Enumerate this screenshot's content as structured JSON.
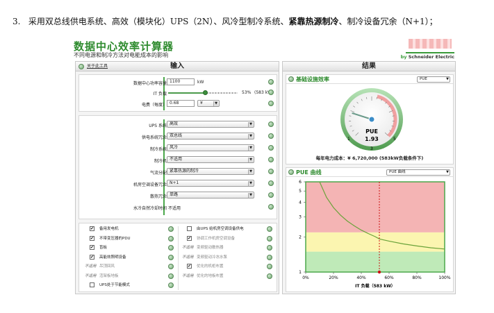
{
  "doc": {
    "pre": "3.   采用双总线供电系统、高效（模块化）UPS（2N）、风冷型制冷系统、",
    "bold": "紧靠热源制冷",
    "post": "、制冷设备冗余（N+1）；"
  },
  "app": {
    "title": "数据中心效率计算器",
    "subtitle": "不同电源和制冷方法对电能成本的影响",
    "brand_by": "by",
    "brand_name": "Schneider Electric"
  },
  "input": {
    "header": "输入",
    "about_link": "关于此工具",
    "capacity": {
      "label": "数据中心功率容量",
      "value": "1100",
      "unit": "kW"
    },
    "it_load": {
      "label": "IT 负载",
      "percent": "53%",
      "kw": "(583 kW)",
      "fraction": 0.53
    },
    "price": {
      "label": "电费（每度）",
      "value": "0.68",
      "currency": "¥"
    },
    "rows": [
      {
        "label": "UPS 系统",
        "value": "高效",
        "type": "select"
      },
      {
        "label": "供电系统冗余",
        "value": "双总线",
        "type": "select"
      },
      {
        "label": "制冷系统",
        "value": "风冷",
        "type": "select"
      },
      {
        "label": "制冷机",
        "value": "不适用",
        "type": "select"
      },
      {
        "label": "气流分配",
        "value": "紧靠热源的制冷",
        "type": "select"
      },
      {
        "label": "机房空调设备冗余",
        "value": "N+1",
        "type": "select"
      },
      {
        "label": "散热冗余",
        "value": "单路",
        "type": "select"
      },
      {
        "label": "水冷自然冷却时间",
        "value": "不适用",
        "type": "static"
      }
    ],
    "options_left": [
      {
        "na": "",
        "checked": true,
        "text": "备用发电机",
        "disabled": false
      },
      {
        "na": "",
        "checked": true,
        "text": "不带变压器的PDU",
        "disabled": false
      },
      {
        "na": "",
        "checked": true,
        "text": "盲板",
        "disabled": false
      },
      {
        "na": "",
        "checked": true,
        "text": "高能效照明设备",
        "disabled": false
      },
      {
        "na": "不适用",
        "checked": null,
        "text": "吊顶回风",
        "disabled": true
      },
      {
        "na": "不适用",
        "checked": null,
        "text": "活架板地板",
        "disabled": true
      },
      {
        "na": "",
        "checked": false,
        "text": "UPS处于节能模式",
        "disabled": false
      }
    ],
    "options_right": [
      {
        "na": "",
        "checked": false,
        "text": "由UPS 给机房空调设备供电",
        "disabled": false
      },
      {
        "na": "",
        "checked": true,
        "text": "协调工作机房空调设备",
        "disabled": true
      },
      {
        "na": "不适用",
        "checked": null,
        "text": "变频驱动散热器",
        "disabled": true
      },
      {
        "na": "不适用",
        "checked": null,
        "text": "变频驱动冷冻水泵",
        "disabled": true
      },
      {
        "na": "",
        "checked": true,
        "text": "优化的机柜布置",
        "disabled": true
      },
      {
        "na": "不适用",
        "checked": null,
        "text": "优化的地板布置",
        "disabled": true
      }
    ]
  },
  "result": {
    "header": "结果",
    "efficiency": {
      "title": "基础设施效率",
      "select": "PUE",
      "gauge_label": "PUE",
      "gauge_value": "1.93",
      "pue": 1.93,
      "gauge_min": "1",
      "gauge_mid": "3",
      "gauge_max": "5",
      "cost_label": "每年电力成本：",
      "cost_value": "¥ 6,720,000 (583kW负载条件下)"
    },
    "curve": {
      "title": "PUE 曲线",
      "select": "PUE 曲线",
      "colors": {
        "red": "#f4b4b4",
        "yellow": "#fbf5b0",
        "green": "#bfeab8",
        "line": "#6aa33a",
        "marker": "#cc1010"
      }
    }
  },
  "chart_data": {
    "type": "line",
    "title": "PUE 曲线",
    "xlabel": "IT 负载（583 kW）",
    "ylabel": "",
    "x_ticks": [
      "0%",
      "20%",
      "40%",
      "60%",
      "80%",
      "100%"
    ],
    "y_ticks": [
      "1",
      "2",
      "3",
      "4",
      "5",
      "6"
    ],
    "xlim": [
      0,
      100
    ],
    "ylim": [
      1,
      6
    ],
    "y_scale": "log",
    "marker_x": 53,
    "marker_y": 1,
    "bands": [
      {
        "from": 1,
        "to": 1.5,
        "color": "green"
      },
      {
        "from": 1.5,
        "to": 2.2,
        "color": "yellow"
      },
      {
        "from": 2.2,
        "to": 6,
        "color": "red"
      }
    ],
    "series": [
      {
        "x": [
          10,
          15,
          20,
          25,
          30,
          35,
          40,
          45,
          50,
          53,
          60,
          70,
          80,
          90,
          100
        ],
        "y": [
          6.0,
          4.4,
          3.6,
          3.1,
          2.75,
          2.5,
          2.3,
          2.15,
          2.02,
          1.93,
          1.85,
          1.75,
          1.68,
          1.62,
          1.58
        ]
      }
    ]
  }
}
